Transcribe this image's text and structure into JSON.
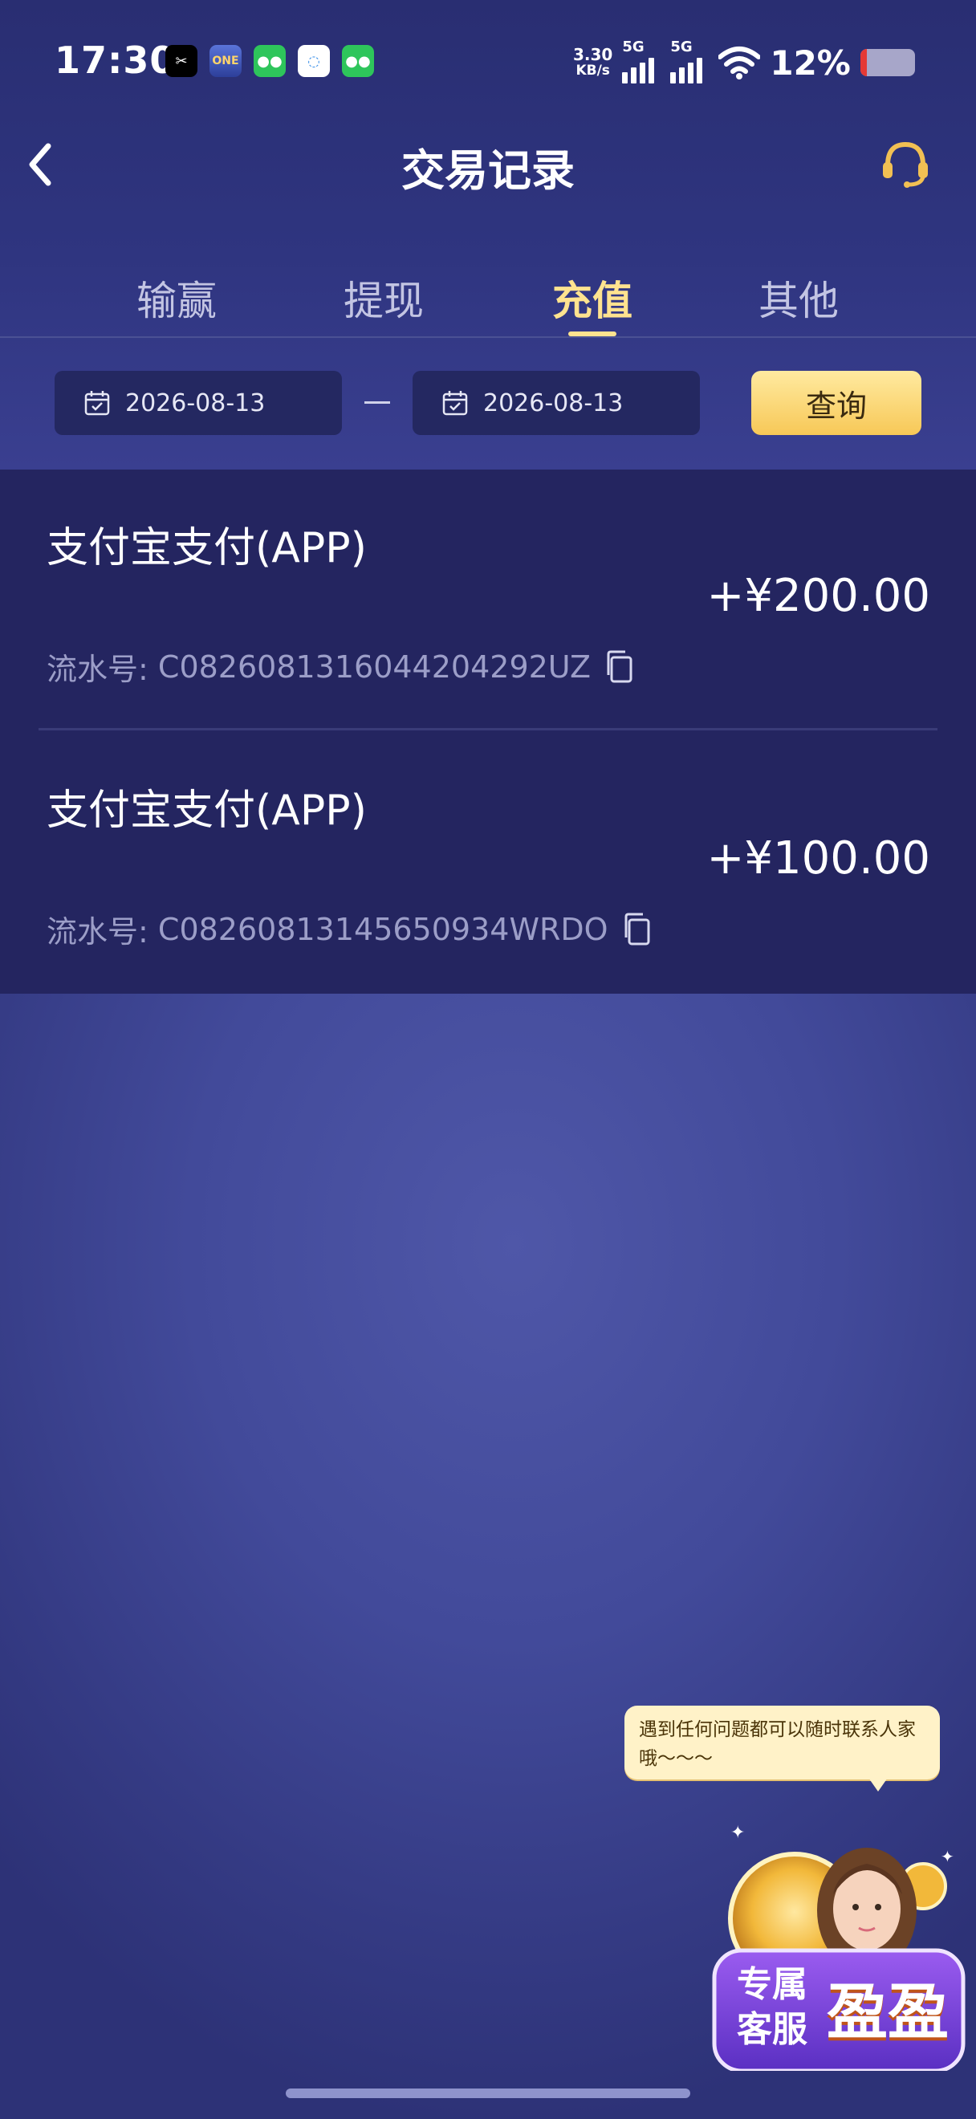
{
  "status_bar": {
    "time": "17:30",
    "net_speed_value": "3.30",
    "net_speed_unit": "KB/s",
    "signal_1_label": "5G",
    "signal_2_label": "5G",
    "battery_pct": "12%",
    "battery_level": 0.12,
    "apps": [
      "capcut-icon",
      "one-app-icon",
      "wechat-icon",
      "chat-bubble-icon",
      "wechat-icon"
    ]
  },
  "header": {
    "title": "交易记录"
  },
  "tabs": [
    {
      "label": "输赢",
      "active": false
    },
    {
      "label": "提现",
      "active": false
    },
    {
      "label": "充值",
      "active": true
    },
    {
      "label": "其他",
      "active": false
    }
  ],
  "filters": {
    "start_date": "2026-08-13",
    "end_date": "2026-08-13",
    "query_label": "查询"
  },
  "records": [
    {
      "title": "支付宝支付(APP)",
      "amount": "+¥200.00",
      "serial_label": "流水号:",
      "serial": "C0826081316044204292UZ"
    },
    {
      "title": "支付宝支付(APP)",
      "amount": "+¥100.00",
      "serial_label": "流水号:",
      "serial": "C08260813145650934WRDO"
    }
  ],
  "support": {
    "bubble_text": "遇到任何问题都可以随时联系人家哦～～～",
    "mascot_line1": "专属",
    "mascot_line2": "客服",
    "mascot_name": "盈盈"
  },
  "colors": {
    "accent_gold": "#ffe38f",
    "button_gold": "#f7c857",
    "card_bg": "#242560",
    "page_bg": "#424a9a"
  }
}
